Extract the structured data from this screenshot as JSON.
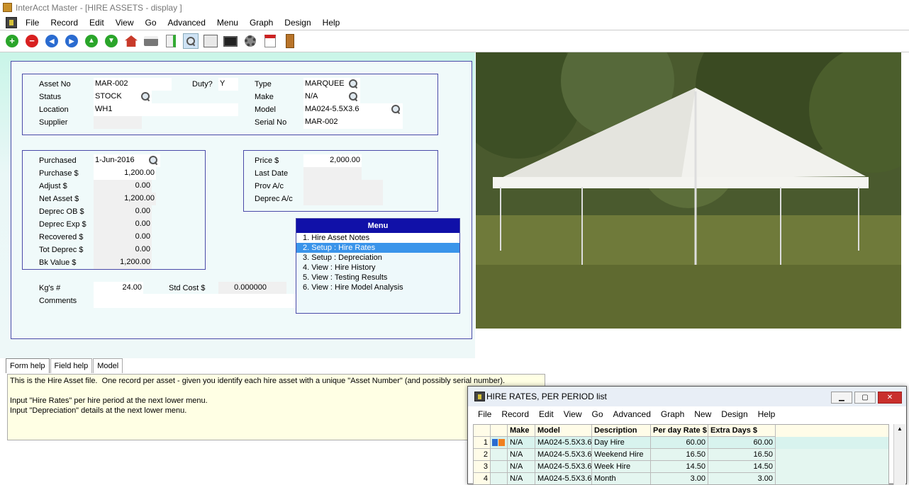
{
  "window": {
    "title": "InterAcct Master - [HIRE ASSETS - display ]"
  },
  "menubar": [
    "File",
    "Record",
    "Edit",
    "View",
    "Go",
    "Advanced",
    "Menu",
    "Graph",
    "Design",
    "Help"
  ],
  "toolbar": {
    "icons": [
      "add-icon",
      "delete-icon",
      "first-record-icon",
      "last-record-icon",
      "up-icon",
      "down-icon",
      "home-icon",
      "print-icon",
      "export-icon",
      "search-icon",
      "calculator-icon",
      "monitor-icon",
      "settings-icon",
      "calendar-icon",
      "exit-door-icon"
    ]
  },
  "asset": {
    "asset_no_label": "Asset No",
    "asset_no": "MAR-002",
    "duty_label": "Duty?",
    "duty": "Y",
    "type_label": "Type",
    "type": "MARQUEE",
    "status_label": "Status",
    "status": "STOCK",
    "make_label": "Make",
    "make": "N/A",
    "location_label": "Location",
    "location": "WH1",
    "model_label": "Model",
    "model": "MA024-5.5X3.6",
    "supplier_label": "Supplier",
    "supplier": "",
    "serial_label": "Serial No",
    "serial": "MAR-002"
  },
  "finance": {
    "purchased_label": "Purchased",
    "purchased": "1-Jun-2016",
    "purchase_label": "Purchase $",
    "purchase": "1,200.00",
    "adjust_label": "Adjust $",
    "adjust": "0.00",
    "net_label": "Net Asset $",
    "net": "1,200.00",
    "deprec_ob_label": "Deprec OB $",
    "deprec_ob": "0.00",
    "deprec_exp_label": "Deprec Exp $",
    "deprec_exp": "0.00",
    "recovered_label": "Recovered $",
    "recovered": "0.00",
    "tot_deprec_label": "Tot Deprec $",
    "tot_deprec": "0.00",
    "bk_value_label": "Bk Value $",
    "bk_value": "1,200.00"
  },
  "pricing": {
    "price_label": "Price $",
    "price": "2,000.00",
    "last_date_label": "Last Date",
    "prov_label": "Prov A/c",
    "deprec_ac_label": "Deprec A/c"
  },
  "misc": {
    "kgs_label": "Kg's #",
    "kgs": "24.00",
    "std_cost_label": "Std Cost $",
    "std_cost": "0.000000",
    "comments_label": "Comments"
  },
  "menu": {
    "title": "Menu",
    "items": [
      "1. Hire Asset Notes",
      "2. Setup : Hire Rates",
      "3. Setup : Depreciation",
      "4. View : Hire History",
      "5. View : Testing Results",
      "6. View : Hire Model Analysis"
    ],
    "selected_index": 1
  },
  "help": {
    "tabs": [
      "Form help",
      "Field help",
      "Model"
    ],
    "active_tab": "Form help",
    "text": "This is the Hire Asset file.  One record per asset - given you identify each hire asset with a unique \"Asset Number\" (and possibly serial number).\n\nInput \"Hire Rates\" per hire period at the next lower menu.\nInput \"Depreciation\" details at the next lower menu."
  },
  "rates_window": {
    "title": "HIRE RATES, PER PERIOD list",
    "menu": [
      "File",
      "Record",
      "Edit",
      "View",
      "Go",
      "Advanced",
      "Graph",
      "New",
      "Design",
      "Help"
    ],
    "columns": [
      "Make",
      "Model",
      "Description",
      "Per day Rate $",
      "Extra Days $"
    ],
    "rows": [
      {
        "n": "1",
        "make": "N/A",
        "model": "MA024-5.5X3.6",
        "desc": "Day Hire",
        "rate": "60.00",
        "extra": "60.00"
      },
      {
        "n": "2",
        "make": "N/A",
        "model": "MA024-5.5X3.6",
        "desc": "Weekend Hire",
        "rate": "16.50",
        "extra": "16.50"
      },
      {
        "n": "3",
        "make": "N/A",
        "model": "MA024-5.5X3.6",
        "desc": "Week Hire",
        "rate": "14.50",
        "extra": "14.50"
      },
      {
        "n": "4",
        "make": "N/A",
        "model": "MA024-5.5X3.6",
        "desc": "Month",
        "rate": "3.00",
        "extra": "3.00"
      }
    ]
  }
}
